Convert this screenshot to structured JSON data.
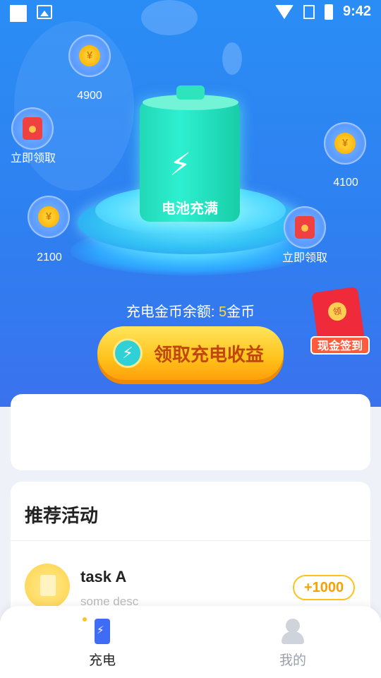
{
  "status_bar": {
    "time": "9:42"
  },
  "hero": {
    "battery_label": "电池充满",
    "bubbles": [
      {
        "type": "coin",
        "label": "4900"
      },
      {
        "type": "redpack",
        "label": "立即领取"
      },
      {
        "type": "coin",
        "label": "4100"
      },
      {
        "type": "coin",
        "label": "2100"
      },
      {
        "type": "redpack",
        "label": "立即领取"
      }
    ],
    "coin_symbol": "¥"
  },
  "balance": {
    "prefix": "充电金币余额: ",
    "value": "5",
    "unit": "金币"
  },
  "claim_button": {
    "label": "领取充电收益"
  },
  "signin_badge": {
    "label": "现金签到",
    "pack_glyph": "领"
  },
  "activities": {
    "title": "推荐活动",
    "items": [
      {
        "name": "task A",
        "desc": "some desc",
        "reward": "+1000"
      }
    ]
  },
  "bottom_nav": [
    {
      "label": "充电",
      "active": true
    },
    {
      "label": "我的",
      "active": false
    }
  ],
  "colors": {
    "primary_blue": "#2f7ff0",
    "gold": "#ffc21b",
    "active_tab": "#222222",
    "inactive_tab": "#9aa0aa"
  }
}
